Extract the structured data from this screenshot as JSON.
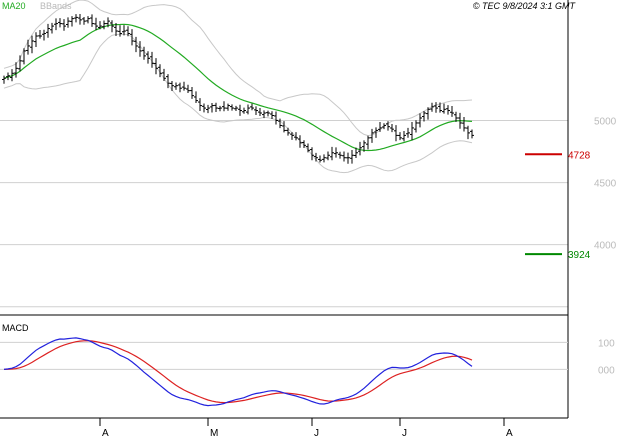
{
  "header": {
    "ma_label": "MA20",
    "bbands_label": "BBands",
    "source": "© TEC 9/8/2024 3:1 GMT"
  },
  "colors": {
    "candle": "#000000",
    "ma": "#22aa22",
    "bands": "#c8c8c8",
    "grid": "#d0d0d0",
    "resistance": "#cc0000",
    "support": "#008800",
    "macd": "#2222dd",
    "signal": "#dd2222"
  },
  "chart_data": [
    {
      "type": "ohlc",
      "x_labels": [
        {
          "label": "A",
          "bar": 24
        },
        {
          "label": "M",
          "bar": 51
        },
        {
          "label": "J",
          "bar": 77
        },
        {
          "label": "J",
          "bar": 99
        },
        {
          "label": "A",
          "bar": 125
        }
      ],
      "ylim": [
        3450,
        5970
      ],
      "y_ticks": [
        5000,
        4500,
        4000
      ],
      "levels": [
        {
          "label": "4728",
          "value": 4728,
          "kind": "resistance"
        },
        {
          "label": "3924",
          "value": 3924,
          "kind": "support"
        }
      ],
      "close": [
        5340,
        5360,
        5380,
        5420,
        5480,
        5560,
        5600,
        5640,
        5680,
        5680,
        5700,
        5740,
        5760,
        5780,
        5780,
        5760,
        5800,
        5820,
        5830,
        5810,
        5800,
        5820,
        5780,
        5760,
        5760,
        5780,
        5800,
        5760,
        5720,
        5700,
        5720,
        5700,
        5640,
        5600,
        5560,
        5520,
        5500,
        5460,
        5420,
        5380,
        5340,
        5300,
        5280,
        5280,
        5260,
        5260,
        5240,
        5200,
        5160,
        5120,
        5100,
        5100,
        5120,
        5100,
        5100,
        5100,
        5120,
        5100,
        5100,
        5080,
        5080,
        5100,
        5100,
        5080,
        5060,
        5060,
        5060,
        5040,
        5000,
        4960,
        4920,
        4900,
        4880,
        4860,
        4820,
        4800,
        4760,
        4720,
        4700,
        4680,
        4700,
        4720,
        4740,
        4740,
        4720,
        4700,
        4700,
        4720,
        4740,
        4780,
        4820,
        4860,
        4900,
        4920,
        4940,
        4960,
        4950,
        4930,
        4880,
        4860,
        4880,
        4900,
        4940,
        4980,
        5020,
        5060,
        5090,
        5110,
        5100,
        5080,
        5090,
        5080,
        5060,
        5020,
        4980,
        4940,
        4900,
        4880
      ],
      "offsets": [
        5340,
        5360,
        5380,
        5420,
        5480,
        5560,
        5600,
        5640,
        5680,
        5680,
        5700,
        5740,
        5760,
        5780,
        5780,
        5760,
        5800,
        5820,
        5830,
        5810,
        5800,
        5820,
        5780,
        5760,
        5760,
        5780,
        5800,
        5760,
        5720,
        5700,
        5720,
        5700,
        5640,
        5600,
        5560,
        5520,
        5500,
        5460,
        5420,
        5380,
        5340,
        5300,
        5280,
        5280,
        5260,
        5260,
        5240,
        5200,
        5160,
        5120,
        5100,
        5100,
        5120,
        5100,
        5100,
        5100,
        5120,
        5100,
        5100,
        5080,
        5080,
        5100,
        5100,
        5080,
        5060,
        5060,
        5060,
        5040,
        5000,
        4960,
        4920,
        4900,
        4880,
        4860,
        4820,
        4800,
        4760,
        4720,
        4700,
        4680,
        4700,
        4720,
        4740,
        4740,
        4720,
        4700,
        4700,
        4720,
        4740,
        4780,
        4820,
        4860,
        4900,
        4920,
        4940,
        4960,
        4950,
        4930,
        4880,
        4860,
        4880,
        4900,
        4940,
        4980,
        5020,
        5060,
        5090,
        5110,
        5100,
        5080,
        5090,
        5080,
        5060,
        5020,
        4980,
        4940,
        4900,
        4880
      ]
    },
    {
      "type": "line",
      "name": "MACD",
      "y_ticks": [
        "100",
        "000"
      ],
      "ylim": [
        -180,
        190
      ]
    }
  ]
}
